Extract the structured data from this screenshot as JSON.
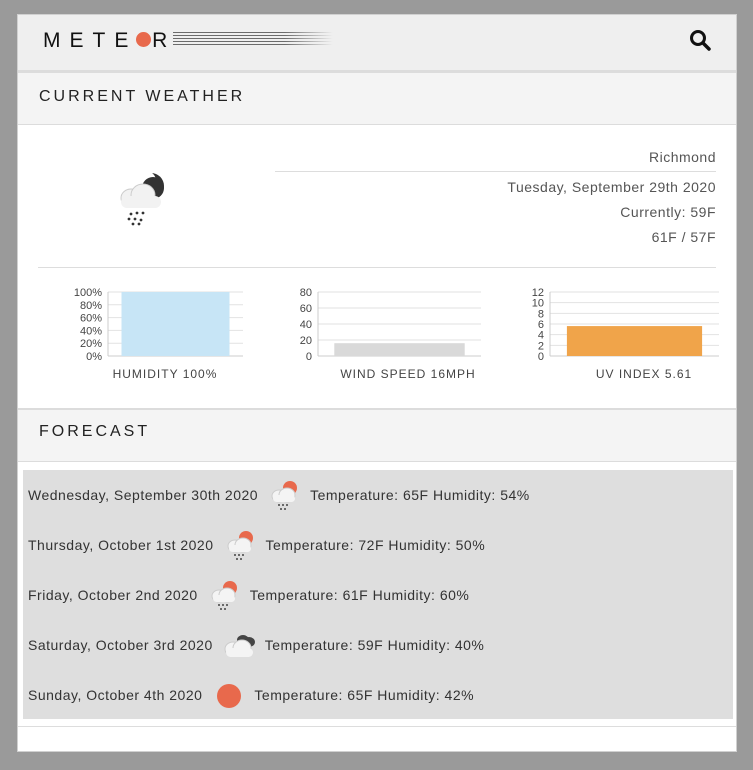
{
  "app": {
    "logo_text": "METE R",
    "search_icon": "search-icon"
  },
  "current": {
    "section_title": "CURRENT WEATHER",
    "icon": "rain-night-icon",
    "city": "Richmond",
    "date": "Tuesday, September 29th 2020",
    "currently": "Currently: 59F",
    "hi_lo": "61F / 57F"
  },
  "charts": {
    "humidity_label": "HUMIDITY 100%",
    "wind_label": "WIND SPEED 16MPH",
    "uv_label": "UV INDEX 5.61"
  },
  "chart_data": [
    {
      "type": "bar",
      "categories": [
        "HUMIDITY"
      ],
      "values": [
        100
      ],
      "ylim": [
        0,
        100
      ],
      "yticks": [
        "0%",
        "20%",
        "40%",
        "60%",
        "80%",
        "100%"
      ],
      "xlabel": "HUMIDITY 100%",
      "color": "#c7e5f6"
    },
    {
      "type": "bar",
      "categories": [
        "WIND SPEED"
      ],
      "values": [
        16
      ],
      "ylim": [
        0,
        80
      ],
      "yticks": [
        "0",
        "20",
        "40",
        "60",
        "80"
      ],
      "xlabel": "WIND SPEED 16MPH",
      "color": "#d9d9d9"
    },
    {
      "type": "bar",
      "categories": [
        "UV INDEX"
      ],
      "values": [
        5.61
      ],
      "ylim": [
        0,
        12
      ],
      "yticks": [
        "0",
        "2",
        "4",
        "6",
        "8",
        "10",
        "12"
      ],
      "xlabel": "UV INDEX 5.61",
      "color": "#f0a44a"
    }
  ],
  "forecast": {
    "section_title": "FORECAST",
    "days": [
      {
        "day": "Wednesday, September 30th 2020",
        "icon": "rain-sun-icon",
        "text": "Temperature: 65F Humidity: 54%"
      },
      {
        "day": "Thursday, October 1st 2020",
        "icon": "rain-sun-icon",
        "text": "Temperature: 72F Humidity: 50%"
      },
      {
        "day": "Friday, October 2nd 2020",
        "icon": "rain-sun-icon",
        "text": "Temperature: 61F Humidity: 60%"
      },
      {
        "day": "Saturday, October 3rd 2020",
        "icon": "cloudy-icon",
        "text": "Temperature: 59F Humidity: 40%"
      },
      {
        "day": "Sunday, October 4th 2020",
        "icon": "sun-icon",
        "text": "Temperature: 65F Humidity: 42%"
      }
    ]
  },
  "colors": {
    "sun": "#e8694c",
    "humidity_bar": "#c7e5f6",
    "wind_bar": "#d9d9d9",
    "uv_bar": "#f0a44a"
  }
}
